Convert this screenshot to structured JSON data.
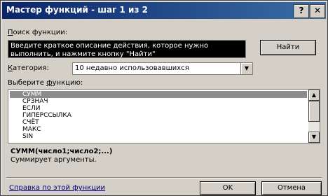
{
  "window": {
    "title": "Мастер функций - шаг 1 из 2",
    "help_button": "?",
    "close_button": "✕"
  },
  "search": {
    "label_access": "П",
    "label_rest": "оиск функции:",
    "value": "Введите краткое описание действия, которое нужно\nвыполнить, и нажмите кнопку \"Найти\"",
    "find_button": "Найти"
  },
  "category": {
    "label_access": "К",
    "label_rest": "атегория:",
    "value": "10 недавно использовавшихся",
    "arrow": "▼"
  },
  "function_list": {
    "label_prefix": "Выберите ",
    "label_access": "ф",
    "label_rest": "ункцию:",
    "items": [
      "СУММ",
      "СРЗНАЧ",
      "ЕСЛИ",
      "ГИПЕРССЫЛКА",
      "СЧЁТ",
      "МАКС",
      "SIN"
    ],
    "selected_index": 0,
    "scroll_up": "▲",
    "scroll_down": "▼"
  },
  "details": {
    "syntax": "СУММ(число1;число2;...)",
    "description": "Суммирует аргументы."
  },
  "footer": {
    "help_link": "Справка по этой функции",
    "ok_button": "OK",
    "cancel_button": "Отмена"
  }
}
